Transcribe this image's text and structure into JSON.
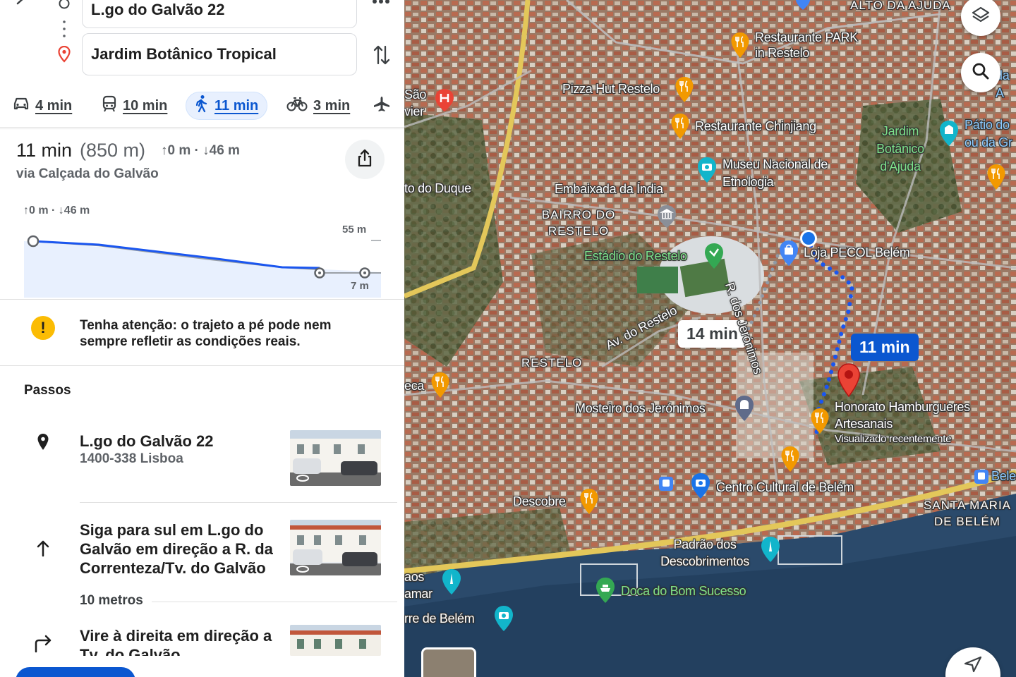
{
  "directions": {
    "origin": "L.go do Galvão 22",
    "destination": "Jardim Botânico Tropical",
    "modes": [
      {
        "name": "car",
        "time": "4 min"
      },
      {
        "name": "transit",
        "time": "10 min"
      },
      {
        "name": "walk",
        "time": "11 min",
        "active": true
      },
      {
        "name": "bike",
        "time": "3 min"
      }
    ]
  },
  "summary": {
    "time": "11 min",
    "distance": "(850 m)",
    "elevation": "↑0 m · ↓46 m",
    "via": "via Calçada do Galvão"
  },
  "elevation_chart": {
    "label": "↑0 m · ↓46 m",
    "max_label": "55 m",
    "min_label": "7 m"
  },
  "warning": "Tenha atenção: o trajeto a pé pode nem sempre refletir as condições reais.",
  "steps": {
    "title": "Passos",
    "items": [
      {
        "title": "L.go do Galvão 22",
        "subtitle": "1400-338 Lisboa"
      },
      {
        "title": "Siga para sul em L.go do Galvão em direção a R. da Correnteza/Tv. do Galvão",
        "distance": "10 metros"
      },
      {
        "title": "Vire à direita em direção a Tv. do Galvão"
      }
    ]
  },
  "map": {
    "labels": {
      "alto_ajuda": "ALTO DA AJUDA",
      "rest_park": "Restaurante PARK in Restelo",
      "pizza_hut": "Pizza Hut Restelo",
      "chinjiang": "Restaurante Chinjiang",
      "etnologia": "Museu Nacional de Etnologia",
      "jardim_ajuda": "Jardim Botânico d'Ajuda",
      "patio": "Pátio do ou da Gr",
      "embaixada": "Embaixada da Índia",
      "bairro_restelo": "BAIRRO DO RESTELO",
      "estadio": "Estádio do Restelo",
      "loja": "Loja PECOL Belém",
      "sao_xavier": "São vier",
      "duque": "to do Duque",
      "av_restelo": "Av. do Restelo",
      "r_jeronimos": "R. dos Jerónimos",
      "restelo": "RESTELO",
      "mosteiro": "Mosteiro dos Jerónimos",
      "honorato": "Honorato Hamburgueres Artesanais",
      "visualizado": "Visualizado recentemente",
      "centro_cultural": "Centro Cultural de Belém",
      "descobre": "Descobre",
      "santa_maria": "SANTA MARIA DE BELÉM",
      "padrao": "Padrão dos Descobrimentos",
      "doca": "Doca do Bom Sucesso",
      "aos_mar": "aos amar",
      "torre": "rre de Belém",
      "eca": "eca",
      "da_a": "da A",
      "bele": "Bele"
    },
    "route_times": {
      "alternative": "14 min",
      "selected": "11 min"
    },
    "colors": {
      "route": "#1a56f0",
      "pin": "#ea4335",
      "food": "#f29900"
    }
  }
}
